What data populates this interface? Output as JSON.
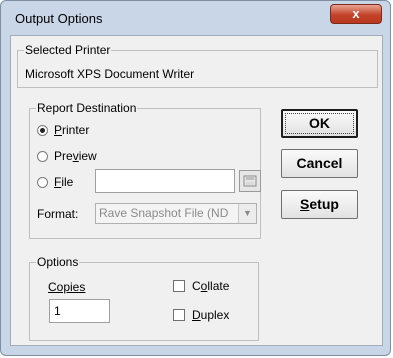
{
  "window": {
    "title": "Output Options",
    "close_glyph": "x"
  },
  "selected_printer": {
    "label": "Selected Printer",
    "name": "Microsoft XPS Document Writer"
  },
  "destination": {
    "label": "Report Destination",
    "printer": {
      "accel": "P",
      "rest": "rinter",
      "selected": true
    },
    "preview": {
      "pre": "Pre",
      "accel": "v",
      "rest": "iew",
      "selected": false
    },
    "file": {
      "accel": "F",
      "rest": "ile",
      "selected": false,
      "value": ""
    },
    "format": {
      "label": "Format:",
      "value": "Rave Snapshot File (ND"
    }
  },
  "options": {
    "label": "Options",
    "copies_label": "Copies",
    "copies_value": "1",
    "collate": {
      "pre": "C",
      "accel": "o",
      "rest": "llate",
      "checked": false
    },
    "duplex": {
      "accel": "D",
      "rest": "uplex",
      "checked": false
    }
  },
  "buttons": {
    "ok": "OK",
    "cancel": "Cancel",
    "setup": {
      "accel": "S",
      "rest": "etup"
    }
  },
  "icons": {
    "browse": "folder-icon",
    "dropdown": "chevron-down-icon"
  }
}
